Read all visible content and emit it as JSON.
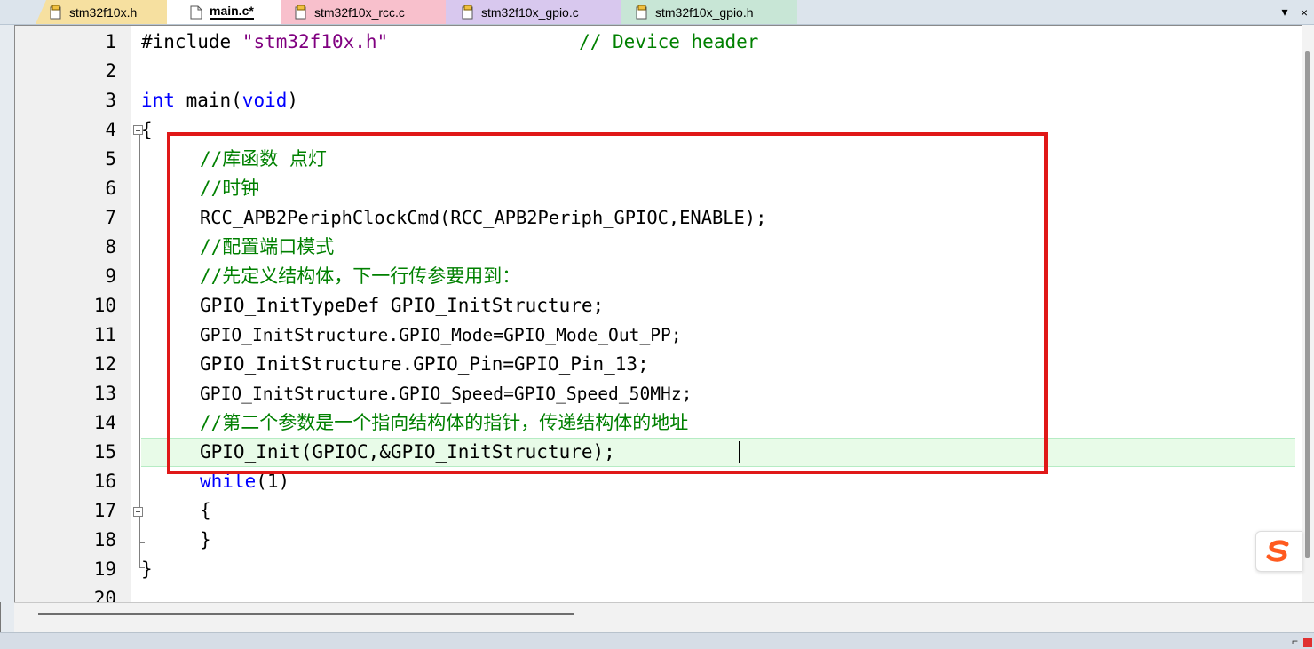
{
  "tabs": [
    {
      "label": "stm32f10x.h",
      "icon": "header-file-icon"
    },
    {
      "label": "main.c*",
      "icon": "c-file-icon",
      "active": true
    },
    {
      "label": "stm32f10x_rcc.c",
      "icon": "c-file-icon"
    },
    {
      "label": "stm32f10x_gpio.c",
      "icon": "c-file-icon"
    },
    {
      "label": "stm32f10x_gpio.h",
      "icon": "header-file-icon"
    }
  ],
  "tab_controls": {
    "dropdown": "▾",
    "close": "×"
  },
  "line_numbers": [
    "1",
    "2",
    "3",
    "4",
    "5",
    "6",
    "7",
    "8",
    "9",
    "10",
    "11",
    "12",
    "13",
    "14",
    "15",
    "16",
    "17",
    "18",
    "19",
    "20"
  ],
  "code": {
    "l1_pre": "#include ",
    "l1_str": "\"stm32f10x.h\"",
    "l1_gap": "                 ",
    "l1_cmt": "// Device header",
    "l3_kw1": "int",
    "l3_mid": " main(",
    "l3_kw2": "void",
    "l3_end": ")",
    "l4": "{",
    "l5": "//库函数 点灯",
    "l6": "//时钟",
    "l7": "RCC_APB2PeriphClockCmd(RCC_APB2Periph_GPIOC,ENABLE);",
    "l8": "//配置端口模式",
    "l9": "//先定义结构体，下一行传参要用到：",
    "l10": "GPIO_InitTypeDef GPIO_InitStructure;",
    "l11": "GPIO_InitStructure.GPIO_Mode=GPIO_Mode_Out_PP;",
    "l12": "GPIO_InitStructure.GPIO_Pin=GPIO_Pin_13;",
    "l13": "GPIO_InitStructure.GPIO_Speed=GPIO_Speed_50MHz;",
    "l14": "//第二个参数是一个指向结构体的指针，传递结构体的地址",
    "l15": "GPIO_Init(GPIOC,&GPIO_InitStructure);",
    "l16_kw": "while",
    "l16_rest": "(1)",
    "l17": "{",
    "l18": "}",
    "l19": "}"
  },
  "colors": {
    "comment": "#008000",
    "keyword": "#0000ff",
    "string": "#800080",
    "highlight_box": "#e01818",
    "current_line": "#e8fbe8"
  },
  "overlay": {
    "ime_icon": "sogou-ime-icon"
  }
}
